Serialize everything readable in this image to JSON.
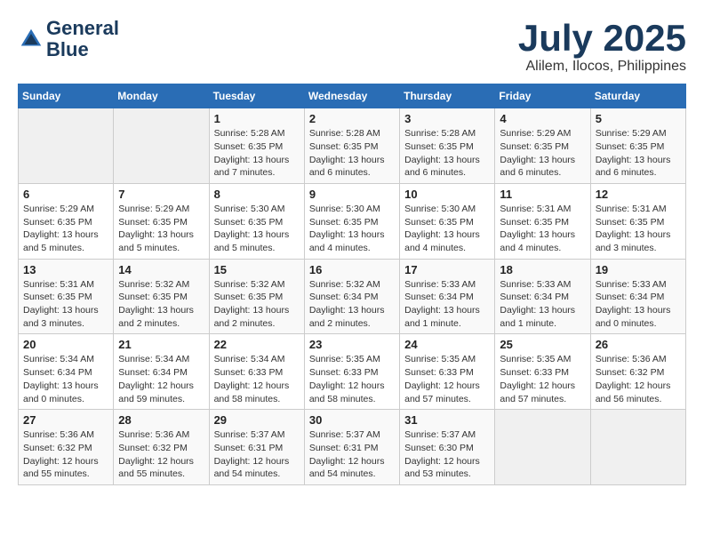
{
  "header": {
    "logo_line1": "General",
    "logo_line2": "Blue",
    "month_year": "July 2025",
    "location": "Alilem, Ilocos, Philippines"
  },
  "weekdays": [
    "Sunday",
    "Monday",
    "Tuesday",
    "Wednesday",
    "Thursday",
    "Friday",
    "Saturday"
  ],
  "weeks": [
    [
      {
        "day": "",
        "info": ""
      },
      {
        "day": "",
        "info": ""
      },
      {
        "day": "1",
        "info": "Sunrise: 5:28 AM\nSunset: 6:35 PM\nDaylight: 13 hours\nand 7 minutes."
      },
      {
        "day": "2",
        "info": "Sunrise: 5:28 AM\nSunset: 6:35 PM\nDaylight: 13 hours\nand 6 minutes."
      },
      {
        "day": "3",
        "info": "Sunrise: 5:28 AM\nSunset: 6:35 PM\nDaylight: 13 hours\nand 6 minutes."
      },
      {
        "day": "4",
        "info": "Sunrise: 5:29 AM\nSunset: 6:35 PM\nDaylight: 13 hours\nand 6 minutes."
      },
      {
        "day": "5",
        "info": "Sunrise: 5:29 AM\nSunset: 6:35 PM\nDaylight: 13 hours\nand 6 minutes."
      }
    ],
    [
      {
        "day": "6",
        "info": "Sunrise: 5:29 AM\nSunset: 6:35 PM\nDaylight: 13 hours\nand 5 minutes."
      },
      {
        "day": "7",
        "info": "Sunrise: 5:29 AM\nSunset: 6:35 PM\nDaylight: 13 hours\nand 5 minutes."
      },
      {
        "day": "8",
        "info": "Sunrise: 5:30 AM\nSunset: 6:35 PM\nDaylight: 13 hours\nand 5 minutes."
      },
      {
        "day": "9",
        "info": "Sunrise: 5:30 AM\nSunset: 6:35 PM\nDaylight: 13 hours\nand 4 minutes."
      },
      {
        "day": "10",
        "info": "Sunrise: 5:30 AM\nSunset: 6:35 PM\nDaylight: 13 hours\nand 4 minutes."
      },
      {
        "day": "11",
        "info": "Sunrise: 5:31 AM\nSunset: 6:35 PM\nDaylight: 13 hours\nand 4 minutes."
      },
      {
        "day": "12",
        "info": "Sunrise: 5:31 AM\nSunset: 6:35 PM\nDaylight: 13 hours\nand 3 minutes."
      }
    ],
    [
      {
        "day": "13",
        "info": "Sunrise: 5:31 AM\nSunset: 6:35 PM\nDaylight: 13 hours\nand 3 minutes."
      },
      {
        "day": "14",
        "info": "Sunrise: 5:32 AM\nSunset: 6:35 PM\nDaylight: 13 hours\nand 2 minutes."
      },
      {
        "day": "15",
        "info": "Sunrise: 5:32 AM\nSunset: 6:35 PM\nDaylight: 13 hours\nand 2 minutes."
      },
      {
        "day": "16",
        "info": "Sunrise: 5:32 AM\nSunset: 6:34 PM\nDaylight: 13 hours\nand 2 minutes."
      },
      {
        "day": "17",
        "info": "Sunrise: 5:33 AM\nSunset: 6:34 PM\nDaylight: 13 hours\nand 1 minute."
      },
      {
        "day": "18",
        "info": "Sunrise: 5:33 AM\nSunset: 6:34 PM\nDaylight: 13 hours\nand 1 minute."
      },
      {
        "day": "19",
        "info": "Sunrise: 5:33 AM\nSunset: 6:34 PM\nDaylight: 13 hours\nand 0 minutes."
      }
    ],
    [
      {
        "day": "20",
        "info": "Sunrise: 5:34 AM\nSunset: 6:34 PM\nDaylight: 13 hours\nand 0 minutes."
      },
      {
        "day": "21",
        "info": "Sunrise: 5:34 AM\nSunset: 6:34 PM\nDaylight: 12 hours\nand 59 minutes."
      },
      {
        "day": "22",
        "info": "Sunrise: 5:34 AM\nSunset: 6:33 PM\nDaylight: 12 hours\nand 58 minutes."
      },
      {
        "day": "23",
        "info": "Sunrise: 5:35 AM\nSunset: 6:33 PM\nDaylight: 12 hours\nand 58 minutes."
      },
      {
        "day": "24",
        "info": "Sunrise: 5:35 AM\nSunset: 6:33 PM\nDaylight: 12 hours\nand 57 minutes."
      },
      {
        "day": "25",
        "info": "Sunrise: 5:35 AM\nSunset: 6:33 PM\nDaylight: 12 hours\nand 57 minutes."
      },
      {
        "day": "26",
        "info": "Sunrise: 5:36 AM\nSunset: 6:32 PM\nDaylight: 12 hours\nand 56 minutes."
      }
    ],
    [
      {
        "day": "27",
        "info": "Sunrise: 5:36 AM\nSunset: 6:32 PM\nDaylight: 12 hours\nand 55 minutes."
      },
      {
        "day": "28",
        "info": "Sunrise: 5:36 AM\nSunset: 6:32 PM\nDaylight: 12 hours\nand 55 minutes."
      },
      {
        "day": "29",
        "info": "Sunrise: 5:37 AM\nSunset: 6:31 PM\nDaylight: 12 hours\nand 54 minutes."
      },
      {
        "day": "30",
        "info": "Sunrise: 5:37 AM\nSunset: 6:31 PM\nDaylight: 12 hours\nand 54 minutes."
      },
      {
        "day": "31",
        "info": "Sunrise: 5:37 AM\nSunset: 6:30 PM\nDaylight: 12 hours\nand 53 minutes."
      },
      {
        "day": "",
        "info": ""
      },
      {
        "day": "",
        "info": ""
      }
    ]
  ]
}
